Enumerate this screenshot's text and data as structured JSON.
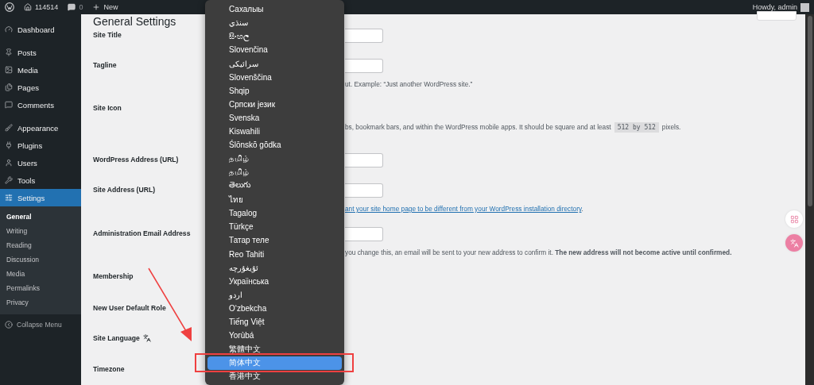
{
  "admin_bar": {
    "site": "114514",
    "comments": "0",
    "new": "New",
    "greeting": "Howdy, admin"
  },
  "sidebar": {
    "items": [
      {
        "label": "Dashboard",
        "selected": false
      },
      {
        "label": "Posts",
        "selected": false
      },
      {
        "label": "Media",
        "selected": false
      },
      {
        "label": "Pages",
        "selected": false
      },
      {
        "label": "Comments",
        "selected": false
      },
      {
        "label": "Appearance",
        "selected": false
      },
      {
        "label": "Plugins",
        "selected": false
      },
      {
        "label": "Users",
        "selected": false
      },
      {
        "label": "Tools",
        "selected": false
      },
      {
        "label": "Settings",
        "selected": true
      }
    ],
    "submenu": [
      {
        "label": "General",
        "selected": true
      },
      {
        "label": "Writing",
        "selected": false
      },
      {
        "label": "Reading",
        "selected": false
      },
      {
        "label": "Discussion",
        "selected": false
      },
      {
        "label": "Media",
        "selected": false
      },
      {
        "label": "Permalinks",
        "selected": false
      },
      {
        "label": "Privacy",
        "selected": false
      }
    ],
    "collapse": "Collapse Menu"
  },
  "page": {
    "title": "General Settings",
    "rows": [
      {
        "label": "Site Title",
        "kind": "input"
      },
      {
        "label": "Tagline",
        "kind": "input",
        "description": "ut. Example: “Just another WordPress site.”"
      },
      {
        "label": "Site Icon",
        "kind": "plain",
        "description": "bs, bookmark bars, and within the WordPress mobile apps. It should be square and at least",
        "code": "512 by 512",
        "after": "pixels."
      },
      {
        "label": "WordPress Address (URL)",
        "kind": "input"
      },
      {
        "label": "Site Address (URL)",
        "kind": "input",
        "link": "ant your site home page to be different from your WordPress installation directory",
        "after": "."
      },
      {
        "label": "Administration Email Address",
        "kind": "input",
        "description": "you change this, an email will be sent to your new address to confirm it. **The new address will not become active until confirmed.**"
      },
      {
        "label": "Membership",
        "kind": "plain"
      },
      {
        "label": "New User Default Role",
        "kind": "plain"
      },
      {
        "label": "Site Language",
        "kind": "language"
      },
      {
        "label": "Timezone",
        "kind": "plain"
      }
    ]
  },
  "language_menu": [
    {
      "label": "Сахалыы",
      "selected": false
    },
    {
      "label": "سنڌي",
      "selected": false
    },
    {
      "label": "සිංහල",
      "selected": false
    },
    {
      "label": "Slovenčina",
      "selected": false
    },
    {
      "label": "سرائیکی",
      "selected": false
    },
    {
      "label": "Slovenščina",
      "selected": false
    },
    {
      "label": "Shqip",
      "selected": false
    },
    {
      "label": "Српски језик",
      "selected": false
    },
    {
      "label": "Svenska",
      "selected": false
    },
    {
      "label": "Kiswahili",
      "selected": false
    },
    {
      "label": "Ślōnskŏ gŏdka",
      "selected": false
    },
    {
      "label": "தமிழ்",
      "selected": false
    },
    {
      "label": "தமிழ்",
      "selected": false
    },
    {
      "label": "తెలుగు",
      "selected": false
    },
    {
      "label": "ไทย",
      "selected": false
    },
    {
      "label": "Tagalog",
      "selected": false
    },
    {
      "label": "Türkçe",
      "selected": false
    },
    {
      "label": "Татар теле",
      "selected": false
    },
    {
      "label": "Reo Tahiti",
      "selected": false
    },
    {
      "label": "ئۇيغۇرچە",
      "selected": false
    },
    {
      "label": "Українська",
      "selected": false
    },
    {
      "label": "اردو",
      "selected": false
    },
    {
      "label": "O‘zbekcha",
      "selected": false
    },
    {
      "label": "Tiếng Việt",
      "selected": false
    },
    {
      "label": "Yorùbá",
      "selected": false
    },
    {
      "label": "繁體中文",
      "selected": false
    },
    {
      "label": "简体中文",
      "selected": true
    },
    {
      "label": "香港中文",
      "selected": false
    }
  ]
}
